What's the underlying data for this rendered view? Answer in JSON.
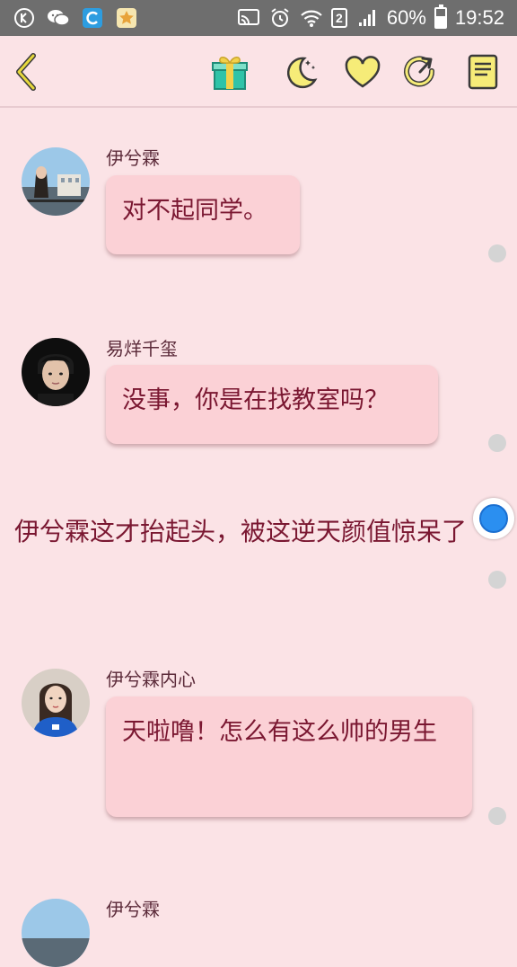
{
  "status_bar": {
    "battery": "60%",
    "battery_level": 0.6,
    "sim": "2",
    "time": "19:52",
    "icons": [
      "k-app-icon",
      "wechat-icon",
      "browser-icon",
      "star-app-icon",
      "cast-icon",
      "alarm-icon",
      "wifi-icon",
      "signal-icon",
      "battery-icon"
    ]
  },
  "toolbar": {
    "icons": [
      "back-icon",
      "gift-icon",
      "moon-icon",
      "heart-icon",
      "refresh-icon",
      "notebook-icon"
    ],
    "accent": "#e6d83c"
  },
  "messages": [
    {
      "speaker": "伊兮霖",
      "text": "对不起同学。",
      "avatar": "girl-city-avatar"
    },
    {
      "speaker": "易烊千玺",
      "text": "没事，你是在找教室吗？",
      "avatar": "boy-avatar"
    },
    {
      "narration": "伊兮霖这才抬起头，被这逆天颜值惊呆了"
    },
    {
      "speaker": "伊兮霖内心",
      "text": "天啦噜！怎么有这么帅的男生",
      "avatar": "girl-blue-avatar"
    },
    {
      "speaker": "伊兮霖",
      "avatar": "girl-city-avatar"
    }
  ],
  "colors": {
    "background": "#fbe3e6",
    "bubble": "#fbd1d6",
    "text": "#7a1731"
  }
}
